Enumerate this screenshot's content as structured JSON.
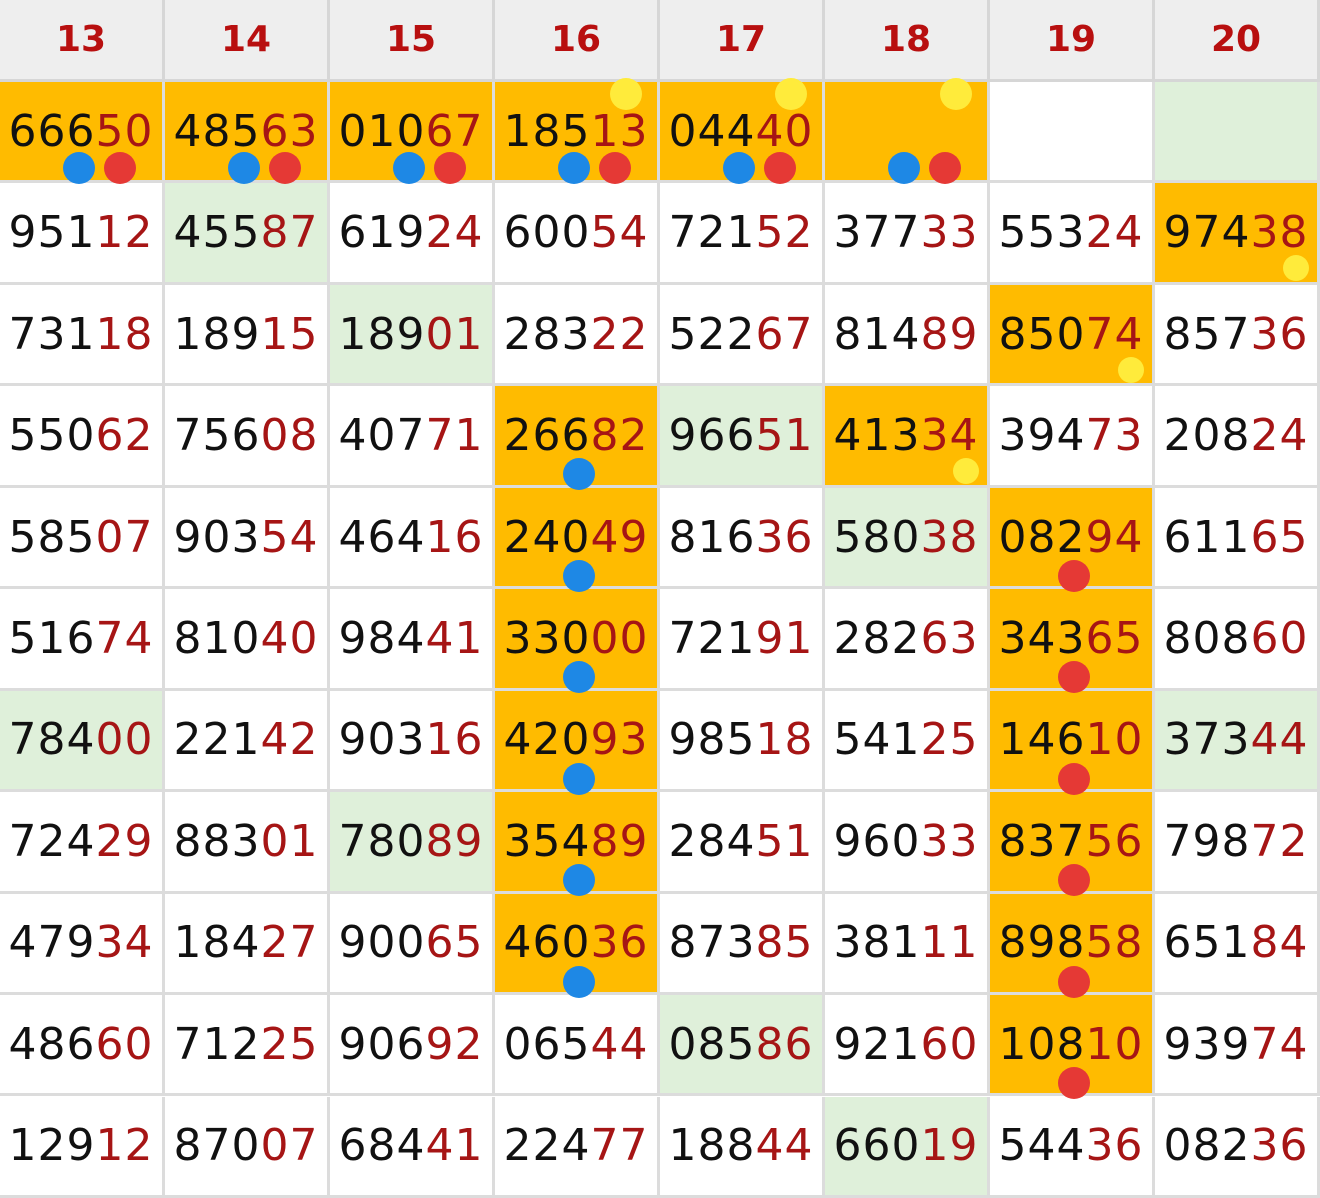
{
  "columns": [
    "13",
    "14",
    "15",
    "16",
    "17",
    "18",
    "19",
    "20"
  ],
  "colors": {
    "highlight_orange": "#ffbb00",
    "highlight_green": "#dff0da",
    "header_text": "#b80f0f",
    "number_suffix": "#a61515",
    "dot_blue": "#1e88e5",
    "dot_red": "#e53935",
    "dot_yellow": "#ffeb3b"
  },
  "rows": [
    [
      {
        "pre": "666",
        "suf": "50",
        "bg": "orange",
        "dots": [
          "blue",
          "red"
        ]
      },
      {
        "pre": "485",
        "suf": "63",
        "bg": "orange",
        "dots": [
          "blue",
          "red"
        ]
      },
      {
        "pre": "010",
        "suf": "67",
        "bg": "orange",
        "dots": [
          "blue",
          "red"
        ]
      },
      {
        "pre": "185",
        "suf": "13",
        "bg": "orange",
        "dots": [
          "blue",
          "red",
          "yellow"
        ]
      },
      {
        "pre": "044",
        "suf": "40",
        "bg": "orange",
        "dots": [
          "blue",
          "red",
          "yellow"
        ]
      },
      {
        "pre": "",
        "suf": "",
        "bg": "orange",
        "dots": [
          "blue",
          "red",
          "yellow"
        ]
      },
      {
        "pre": "",
        "suf": "",
        "bg": "white",
        "dots": []
      },
      {
        "pre": "",
        "suf": "",
        "bg": "green",
        "dots": []
      }
    ],
    [
      {
        "pre": "951",
        "suf": "12",
        "bg": "white",
        "dots": []
      },
      {
        "pre": "455",
        "suf": "87",
        "bg": "green",
        "dots": []
      },
      {
        "pre": "619",
        "suf": "24",
        "bg": "white",
        "dots": []
      },
      {
        "pre": "600",
        "suf": "54",
        "bg": "white",
        "dots": []
      },
      {
        "pre": "721",
        "suf": "52",
        "bg": "white",
        "dots": []
      },
      {
        "pre": "377",
        "suf": "33",
        "bg": "white",
        "dots": []
      },
      {
        "pre": "553",
        "suf": "24",
        "bg": "white",
        "dots": []
      },
      {
        "pre": "974",
        "suf": "38",
        "bg": "orange",
        "dots": [
          "yellow"
        ]
      }
    ],
    [
      {
        "pre": "731",
        "suf": "18",
        "bg": "white",
        "dots": []
      },
      {
        "pre": "189",
        "suf": "15",
        "bg": "white",
        "dots": []
      },
      {
        "pre": "189",
        "suf": "01",
        "bg": "green",
        "dots": []
      },
      {
        "pre": "283",
        "suf": "22",
        "bg": "white",
        "dots": []
      },
      {
        "pre": "522",
        "suf": "67",
        "bg": "white",
        "dots": []
      },
      {
        "pre": "814",
        "suf": "89",
        "bg": "white",
        "dots": []
      },
      {
        "pre": "850",
        "suf": "74",
        "bg": "orange",
        "dots": [
          "yellow"
        ]
      },
      {
        "pre": "857",
        "suf": "36",
        "bg": "white",
        "dots": []
      }
    ],
    [
      {
        "pre": "550",
        "suf": "62",
        "bg": "white",
        "dots": []
      },
      {
        "pre": "756",
        "suf": "08",
        "bg": "white",
        "dots": []
      },
      {
        "pre": "407",
        "suf": "71",
        "bg": "white",
        "dots": []
      },
      {
        "pre": "266",
        "suf": "82",
        "bg": "orange",
        "dots": [
          "blue"
        ]
      },
      {
        "pre": "966",
        "suf": "51",
        "bg": "green",
        "dots": []
      },
      {
        "pre": "413",
        "suf": "34",
        "bg": "orange",
        "dots": [
          "yellow"
        ]
      },
      {
        "pre": "394",
        "suf": "73",
        "bg": "white",
        "dots": []
      },
      {
        "pre": "208",
        "suf": "24",
        "bg": "white",
        "dots": []
      }
    ],
    [
      {
        "pre": "585",
        "suf": "07",
        "bg": "white",
        "dots": []
      },
      {
        "pre": "903",
        "suf": "54",
        "bg": "white",
        "dots": []
      },
      {
        "pre": "464",
        "suf": "16",
        "bg": "white",
        "dots": []
      },
      {
        "pre": "240",
        "suf": "49",
        "bg": "orange",
        "dots": [
          "blue"
        ]
      },
      {
        "pre": "816",
        "suf": "36",
        "bg": "white",
        "dots": []
      },
      {
        "pre": "580",
        "suf": "38",
        "bg": "green",
        "dots": []
      },
      {
        "pre": "082",
        "suf": "94",
        "bg": "orange",
        "dots": [
          "red"
        ]
      },
      {
        "pre": "611",
        "suf": "65",
        "bg": "white",
        "dots": []
      }
    ],
    [
      {
        "pre": "516",
        "suf": "74",
        "bg": "white",
        "dots": []
      },
      {
        "pre": "810",
        "suf": "40",
        "bg": "white",
        "dots": []
      },
      {
        "pre": "984",
        "suf": "41",
        "bg": "white",
        "dots": []
      },
      {
        "pre": "330",
        "suf": "00",
        "bg": "orange",
        "dots": [
          "blue"
        ]
      },
      {
        "pre": "721",
        "suf": "91",
        "bg": "white",
        "dots": []
      },
      {
        "pre": "282",
        "suf": "63",
        "bg": "white",
        "dots": []
      },
      {
        "pre": "343",
        "suf": "65",
        "bg": "orange",
        "dots": [
          "red"
        ]
      },
      {
        "pre": "808",
        "suf": "60",
        "bg": "white",
        "dots": []
      }
    ],
    [
      {
        "pre": "784",
        "suf": "00",
        "bg": "green",
        "dots": []
      },
      {
        "pre": "221",
        "suf": "42",
        "bg": "white",
        "dots": []
      },
      {
        "pre": "903",
        "suf": "16",
        "bg": "white",
        "dots": []
      },
      {
        "pre": "420",
        "suf": "93",
        "bg": "orange",
        "dots": [
          "blue"
        ]
      },
      {
        "pre": "985",
        "suf": "18",
        "bg": "white",
        "dots": []
      },
      {
        "pre": "541",
        "suf": "25",
        "bg": "white",
        "dots": []
      },
      {
        "pre": "146",
        "suf": "10",
        "bg": "orange",
        "dots": [
          "red"
        ]
      },
      {
        "pre": "373",
        "suf": "44",
        "bg": "green",
        "dots": []
      }
    ],
    [
      {
        "pre": "724",
        "suf": "29",
        "bg": "white",
        "dots": []
      },
      {
        "pre": "883",
        "suf": "01",
        "bg": "white",
        "dots": []
      },
      {
        "pre": "780",
        "suf": "89",
        "bg": "green",
        "dots": []
      },
      {
        "pre": "354",
        "suf": "89",
        "bg": "orange",
        "dots": [
          "blue"
        ]
      },
      {
        "pre": "284",
        "suf": "51",
        "bg": "white",
        "dots": []
      },
      {
        "pre": "960",
        "suf": "33",
        "bg": "white",
        "dots": []
      },
      {
        "pre": "837",
        "suf": "56",
        "bg": "orange",
        "dots": [
          "red"
        ]
      },
      {
        "pre": "798",
        "suf": "72",
        "bg": "white",
        "dots": []
      }
    ],
    [
      {
        "pre": "479",
        "suf": "34",
        "bg": "white",
        "dots": []
      },
      {
        "pre": "184",
        "suf": "27",
        "bg": "white",
        "dots": []
      },
      {
        "pre": "900",
        "suf": "65",
        "bg": "white",
        "dots": []
      },
      {
        "pre": "460",
        "suf": "36",
        "bg": "orange",
        "dots": [
          "blue"
        ]
      },
      {
        "pre": "873",
        "suf": "85",
        "bg": "white",
        "dots": []
      },
      {
        "pre": "381",
        "suf": "11",
        "bg": "white",
        "dots": []
      },
      {
        "pre": "898",
        "suf": "58",
        "bg": "orange",
        "dots": [
          "red"
        ]
      },
      {
        "pre": "651",
        "suf": "84",
        "bg": "white",
        "dots": []
      }
    ],
    [
      {
        "pre": "486",
        "suf": "60",
        "bg": "white",
        "dots": []
      },
      {
        "pre": "712",
        "suf": "25",
        "bg": "white",
        "dots": []
      },
      {
        "pre": "906",
        "suf": "92",
        "bg": "white",
        "dots": []
      },
      {
        "pre": "065",
        "suf": "44",
        "bg": "white",
        "dots": []
      },
      {
        "pre": "085",
        "suf": "86",
        "bg": "green",
        "dots": []
      },
      {
        "pre": "921",
        "suf": "60",
        "bg": "white",
        "dots": []
      },
      {
        "pre": "108",
        "suf": "10",
        "bg": "orange",
        "dots": [
          "red"
        ]
      },
      {
        "pre": "939",
        "suf": "74",
        "bg": "white",
        "dots": []
      }
    ],
    [
      {
        "pre": "129",
        "suf": "12",
        "bg": "white",
        "dots": []
      },
      {
        "pre": "870",
        "suf": "07",
        "bg": "white",
        "dots": []
      },
      {
        "pre": "684",
        "suf": "41",
        "bg": "white",
        "dots": []
      },
      {
        "pre": "224",
        "suf": "77",
        "bg": "white",
        "dots": []
      },
      {
        "pre": "188",
        "suf": "44",
        "bg": "white",
        "dots": []
      },
      {
        "pre": "660",
        "suf": "19",
        "bg": "green",
        "dots": []
      },
      {
        "pre": "544",
        "suf": "36",
        "bg": "white",
        "dots": []
      },
      {
        "pre": "082",
        "suf": "36",
        "bg": "white",
        "dots": []
      }
    ]
  ]
}
